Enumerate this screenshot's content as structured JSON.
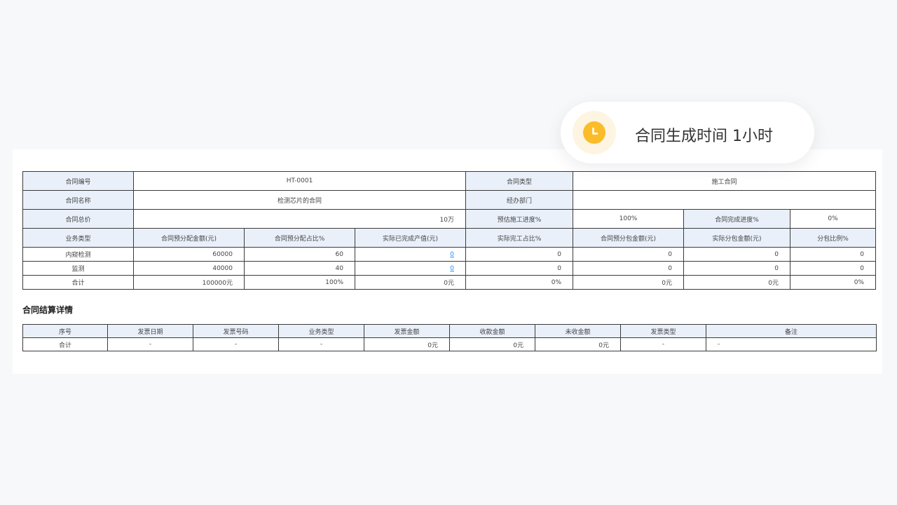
{
  "toast": {
    "icon": "clock-icon",
    "icon_color": "#fbbc2a",
    "message": "合同生成时间 1小时"
  },
  "contract": {
    "id_label": "合同编号",
    "id_value": "HT-0001",
    "type_label": "合同类型",
    "type_value": "施工合同",
    "name_label": "合同名称",
    "name_value": "检测芯片的合同",
    "dept_label": "经办部门",
    "dept_value": "",
    "total_label": "合同总价",
    "total_value": "10万",
    "construction_label": "预估施工进度%",
    "construction_value": "100%",
    "completion_label": "合同完成进度%",
    "completion_value": "0%",
    "columns": [
      "业务类型",
      "合同预分配金额(元)",
      "合同预分配占比%",
      "实际已完成产值(元)",
      "实际完工占比%",
      "合同预分包金额(元)",
      "实际分包金额(元)",
      "分包比例%"
    ],
    "rows": [
      {
        "type": "内窥检测",
        "alloc_amount": "60000",
        "alloc_ratio": "60",
        "actual_output": "0",
        "completion_ratio": "0",
        "pre_sub_amount": "0",
        "actual_sub_amount": "0",
        "sub_ratio": "0"
      },
      {
        "type": "监测",
        "alloc_amount": "40000",
        "alloc_ratio": "40",
        "actual_output": "0",
        "completion_ratio": "0",
        "pre_sub_amount": "0",
        "actual_sub_amount": "0",
        "sub_ratio": "0"
      }
    ],
    "total_row": {
      "type": "合计",
      "alloc_amount": "100000元",
      "alloc_ratio": "100%",
      "actual_output": "0元",
      "completion_ratio": "0%",
      "pre_sub_amount": "0元",
      "actual_sub_amount": "0元",
      "sub_ratio": "0%"
    }
  },
  "settlement": {
    "title": "合同结算详情",
    "columns": [
      "序号",
      "发票日期",
      "发票号码",
      "业务类型",
      "发票金额",
      "收款金额",
      "未收金额",
      "发票类型",
      "备注"
    ],
    "total_row": {
      "index": "合计",
      "invoice_date": "-",
      "invoice_no": "-",
      "business_type": "-",
      "invoice_amount": "0元",
      "received_amount": "0元",
      "unreceived_amount": "0元",
      "invoice_type": "-",
      "remark": "-"
    }
  }
}
